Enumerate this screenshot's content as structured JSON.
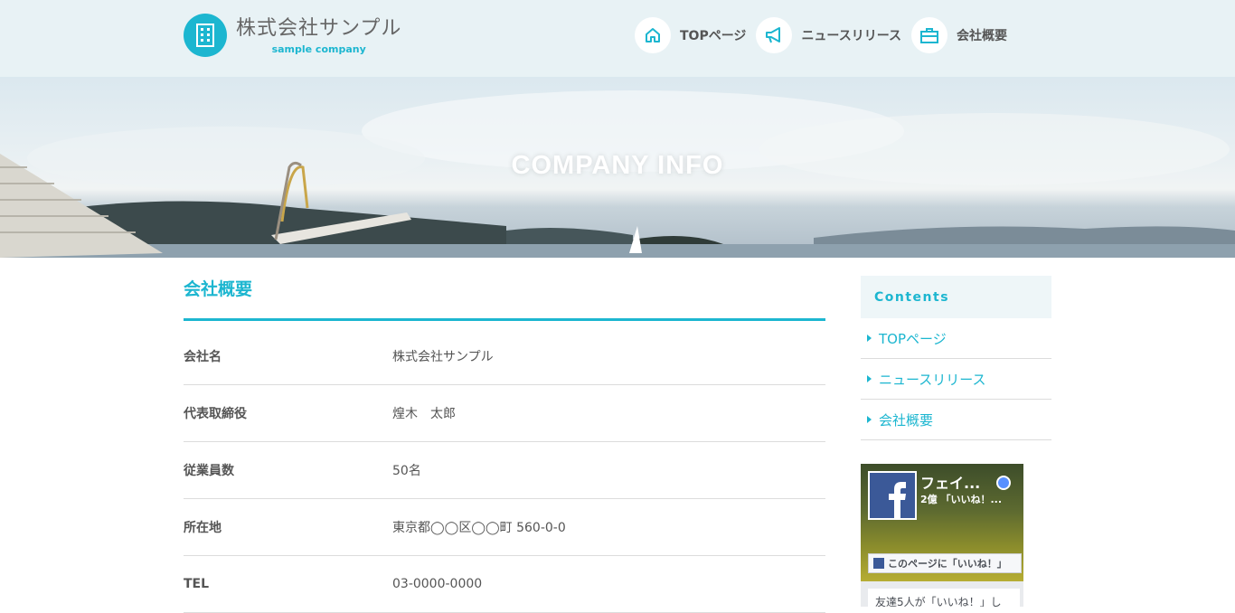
{
  "header": {
    "logo_name": "株式会社サンプル",
    "logo_sub": "sample company",
    "nav": [
      {
        "label": "TOPページ",
        "icon": "home-icon"
      },
      {
        "label": "ニュースリリース",
        "icon": "megaphone-icon"
      },
      {
        "label": "会社概要",
        "icon": "briefcase-icon"
      }
    ]
  },
  "hero": {
    "title": "COMPANY INFO"
  },
  "main": {
    "heading": "会社概要",
    "rows": [
      {
        "key": "会社名",
        "value": "株式会社サンプル"
      },
      {
        "key": "代表取締役",
        "value": "煌木　太郎"
      },
      {
        "key": "従業員数",
        "value": "50名"
      },
      {
        "key": "所在地",
        "value": "東京都◯◯区◯◯町 560-0-0"
      },
      {
        "key": "TEL",
        "value": "03-0000-0000"
      }
    ]
  },
  "sidebar": {
    "heading": "Contents",
    "items": [
      {
        "label": "TOPページ"
      },
      {
        "label": "ニュースリリース"
      },
      {
        "label": "会社概要"
      }
    ]
  },
  "facebook": {
    "page_name": "フェイ...",
    "likes": "2億 「いいね！...",
    "like_button": "このページに「いいね！」",
    "friends": "友達5人が「いいね！」し"
  },
  "colors": {
    "accent": "#1cb6d0",
    "header_bg": "#e8f2f5"
  }
}
